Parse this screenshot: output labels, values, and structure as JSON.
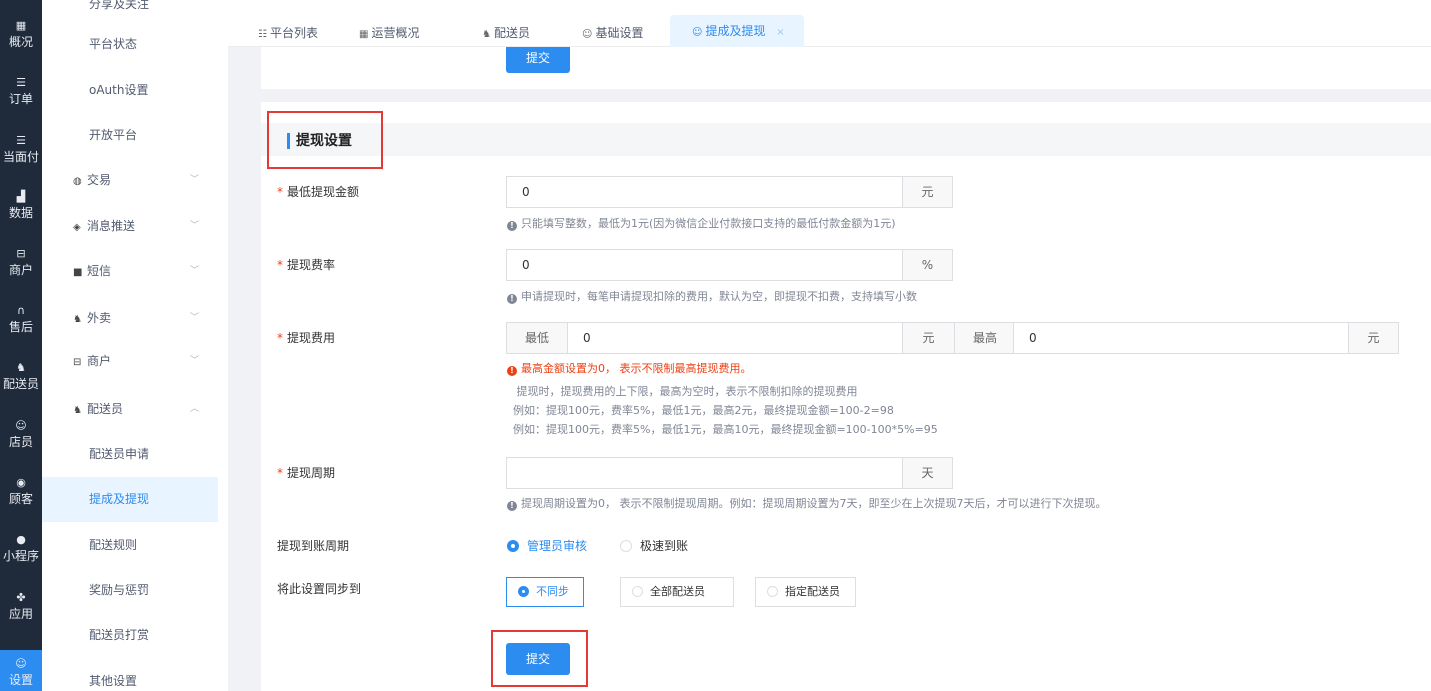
{
  "rail": {
    "items": [
      {
        "label": "概况",
        "icon": "grid-icon",
        "glyph": "▦"
      },
      {
        "label": "订单",
        "icon": "list-icon",
        "glyph": "☰"
      },
      {
        "label": "当面付",
        "icon": "list-icon",
        "glyph": "☰"
      },
      {
        "label": "数据",
        "icon": "bar-chart-icon",
        "glyph": "▟"
      },
      {
        "label": "商户",
        "icon": "store-icon",
        "glyph": "⊟"
      },
      {
        "label": "售后",
        "icon": "headset-icon",
        "glyph": "∩"
      },
      {
        "label": "配送员",
        "icon": "scooter-icon",
        "glyph": "♞"
      },
      {
        "label": "店员",
        "icon": "users-icon",
        "glyph": "☺"
      },
      {
        "label": "顾客",
        "icon": "customer-icon",
        "glyph": "◉"
      },
      {
        "label": "小程序",
        "icon": "wechat-icon",
        "glyph": "●"
      },
      {
        "label": "应用",
        "icon": "apps-icon",
        "glyph": "✤"
      },
      {
        "label": "设置",
        "icon": "settings-user-icon",
        "glyph": "☺"
      }
    ]
  },
  "submenu": {
    "items": [
      {
        "label": "分享及关注",
        "kind": "child"
      },
      {
        "label": "平台状态",
        "kind": "child"
      },
      {
        "label": "oAuth设置",
        "kind": "child"
      },
      {
        "label": "开放平台",
        "kind": "child"
      },
      {
        "label": "交易",
        "kind": "group",
        "icon": "trade-icon",
        "glyph": "◍",
        "arrow": "﹀"
      },
      {
        "label": "消息推送",
        "kind": "group",
        "icon": "message-icon",
        "glyph": "◈",
        "arrow": "﹀"
      },
      {
        "label": "短信",
        "kind": "group",
        "icon": "sms-icon",
        "glyph": "■",
        "arrow": "﹀"
      },
      {
        "label": "外卖",
        "kind": "group",
        "icon": "takeout-icon",
        "glyph": "♞",
        "arrow": "﹀"
      },
      {
        "label": "商户",
        "kind": "group",
        "icon": "store-icon",
        "glyph": "⊟",
        "arrow": "﹀"
      },
      {
        "label": "配送员",
        "kind": "group",
        "icon": "courier-icon",
        "glyph": "♞",
        "arrow": "︿"
      },
      {
        "label": "配送员申请",
        "kind": "child"
      },
      {
        "label": "提成及提现",
        "kind": "child",
        "selected": true
      },
      {
        "label": "配送规则",
        "kind": "child"
      },
      {
        "label": "奖励与惩罚",
        "kind": "child"
      },
      {
        "label": "配送员打赏",
        "kind": "child"
      },
      {
        "label": "其他设置",
        "kind": "child"
      }
    ]
  },
  "tabs": [
    {
      "label": "平台列表",
      "icon": "list-icon",
      "glyph": "☷"
    },
    {
      "label": "运营概况",
      "icon": "grid-icon",
      "glyph": "▦"
    },
    {
      "label": "配送员",
      "icon": "courier-icon",
      "glyph": "♞"
    },
    {
      "label": "基础设置",
      "icon": "user-icon",
      "glyph": "☺"
    },
    {
      "label": "提成及提现",
      "icon": "user-icon",
      "glyph": "☺",
      "active": true,
      "close": "×"
    }
  ],
  "top_submit": "提交",
  "section": {
    "title": "提现设置"
  },
  "form": {
    "min_amount": {
      "label": "最低提现金额",
      "value": "0",
      "unit": "元",
      "hint": "只能填写整数，最低为1元(因为微信企业付款接口支持的最低付款金额为1元)"
    },
    "fee_rate": {
      "label": "提现费率",
      "value": "0",
      "unit": "%",
      "hint": "申请提现时，每笔申请提现扣除的费用，默认为空，即提现不扣费，支持填写小数"
    },
    "fee": {
      "label": "提现费用",
      "min_label": "最低",
      "min_value": "0",
      "min_unit": "元",
      "max_label": "最高",
      "max_value": "0",
      "max_unit": "元",
      "warn": "最高金额设置为0， 表示不限制最高提现费用。",
      "hint1": "提现时，提现费用的上下限，最高为空时，表示不限制扣除的提现费用",
      "hint2": "例如：提现100元，费率5%，最低1元，最高2元，最终提现金额=100-2=98",
      "hint3": "例如：提现100元，费率5%，最低1元，最高10元，最终提现金额=100-100*5%=95"
    },
    "cycle": {
      "label": "提现周期",
      "value": "",
      "unit": "天",
      "hint": "提现周期设置为0， 表示不限制提现周期。例如：提现周期设置为7天，即至少在上次提现7天后，才可以进行下次提现。"
    },
    "arrival": {
      "label": "提现到账周期",
      "options": [
        "管理员审核",
        "极速到账"
      ],
      "selected": 0
    },
    "sync": {
      "label": "将此设置同步到",
      "options": [
        "不同步",
        "全部配送员",
        "指定配送员"
      ],
      "selected": 0
    },
    "submit": "提交"
  },
  "colors": {
    "primary": "#2d8cf0",
    "rail": "#1f2a3a",
    "highlight": "#e53935",
    "danger": "#ed4014"
  }
}
